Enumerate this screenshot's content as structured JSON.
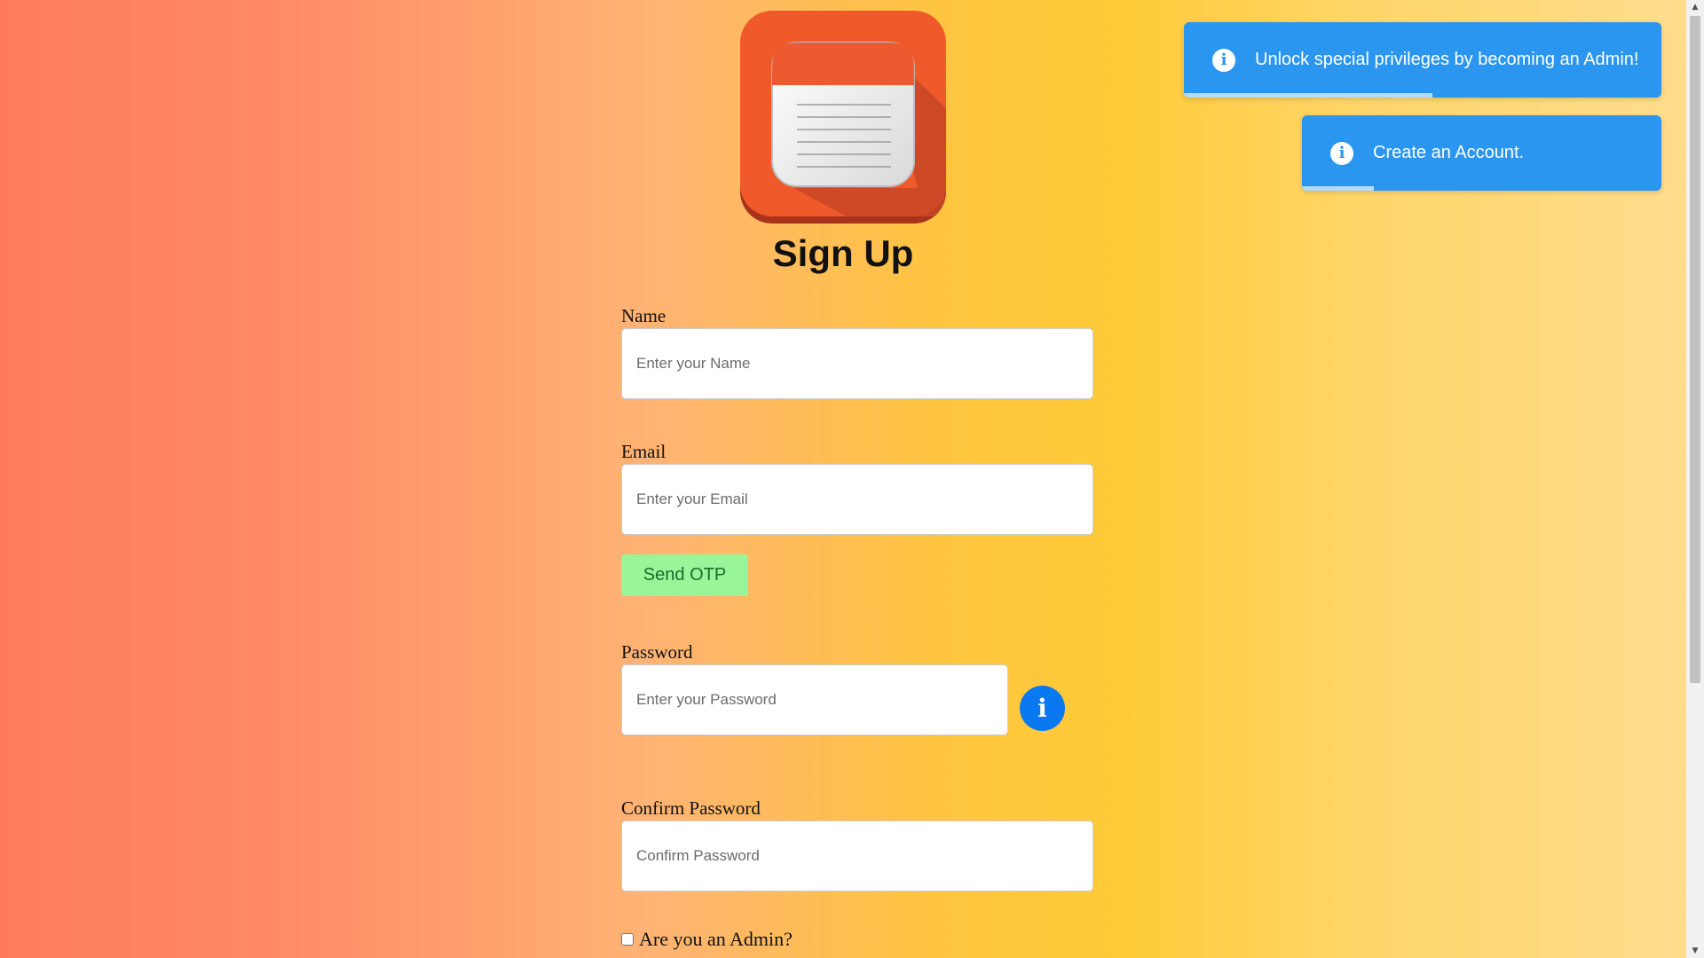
{
  "page": {
    "title": "Sign Up"
  },
  "logo": {
    "icon": "notepad-icon",
    "colors": {
      "tile": "#f05a2b",
      "header": "#ee5a30",
      "paper": "#efefef"
    }
  },
  "form": {
    "name": {
      "label": "Name",
      "placeholder": "Enter your Name"
    },
    "email": {
      "label": "Email",
      "placeholder": "Enter your Email"
    },
    "send_otp": "Send OTP",
    "password": {
      "label": "Password",
      "placeholder": "Enter your Password",
      "info_icon": "info-icon",
      "info_glyph": "i"
    },
    "confirm_password": {
      "label": "Confirm Password",
      "placeholder": "Confirm Password"
    },
    "admin_checkbox": {
      "label": "Are you an Admin?",
      "checked": false
    }
  },
  "toasts": [
    {
      "icon": "info-icon",
      "glyph": "i",
      "message": "Unlock special privileges by becoming an Admin!",
      "progress": 0.52
    },
    {
      "icon": "info-icon",
      "glyph": "i",
      "message": "Create an Account.",
      "progress": 0.2
    }
  ],
  "colors": {
    "toast": "#2b96ef",
    "info_button": "#0a78f0",
    "otp_button": "#98f598"
  },
  "scrollbar": {
    "up": "▲",
    "down": "▼"
  }
}
